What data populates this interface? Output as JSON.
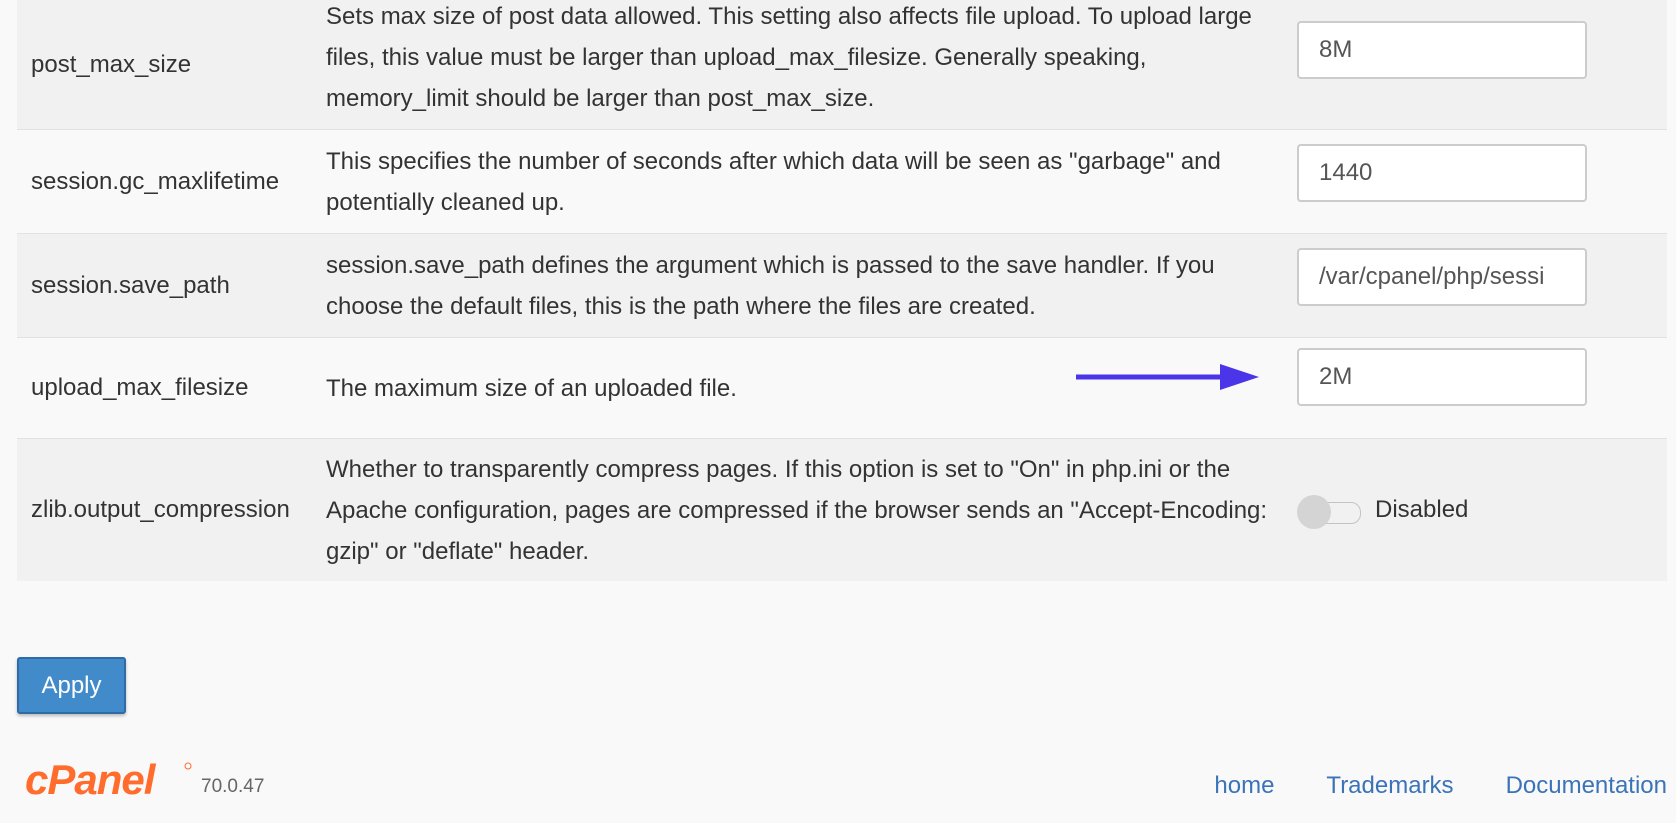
{
  "settings": [
    {
      "name": "post_max_size",
      "description": "Sets max size of post data allowed. This setting also affects file upload. To upload large files, this value must be larger than upload_max_filesize. Generally speaking, memory_limit should be larger than post_max_size.",
      "value": "8M"
    },
    {
      "name": "session.gc_maxlifetime",
      "description": "This specifies the number of seconds after which data will be seen as \"garbage\" and potentially cleaned up.",
      "value": "1440"
    },
    {
      "name": "session.save_path",
      "description": "session.save_path defines the argument which is passed to the save handler. If you choose the default files, this is the path where the files are created.",
      "value": "/var/cpanel/php/sessi"
    },
    {
      "name": "upload_max_filesize",
      "description": "The maximum size of an uploaded file.",
      "value": "2M"
    },
    {
      "name": "zlib.output_compression",
      "description": "Whether to transparently compress pages. If this option is set to \"On\" in php.ini or the Apache configuration, pages are compressed if the browser sends an \"Accept-Encoding: gzip\" or \"deflate\" header.",
      "toggle_state": "Disabled"
    }
  ],
  "apply_label": "Apply",
  "footer": {
    "logo_text": "cPanel",
    "version": "70.0.47",
    "links": [
      "home",
      "Trademarks",
      "Documentation"
    ]
  },
  "colors": {
    "arrow": "#4a35e8",
    "apply_bg": "#428bca",
    "brand": "#ff6c2c",
    "link": "#3b73b9"
  },
  "icons": {
    "annotation_arrow": "arrow-right-icon",
    "toggle": "toggle-switch-icon"
  }
}
